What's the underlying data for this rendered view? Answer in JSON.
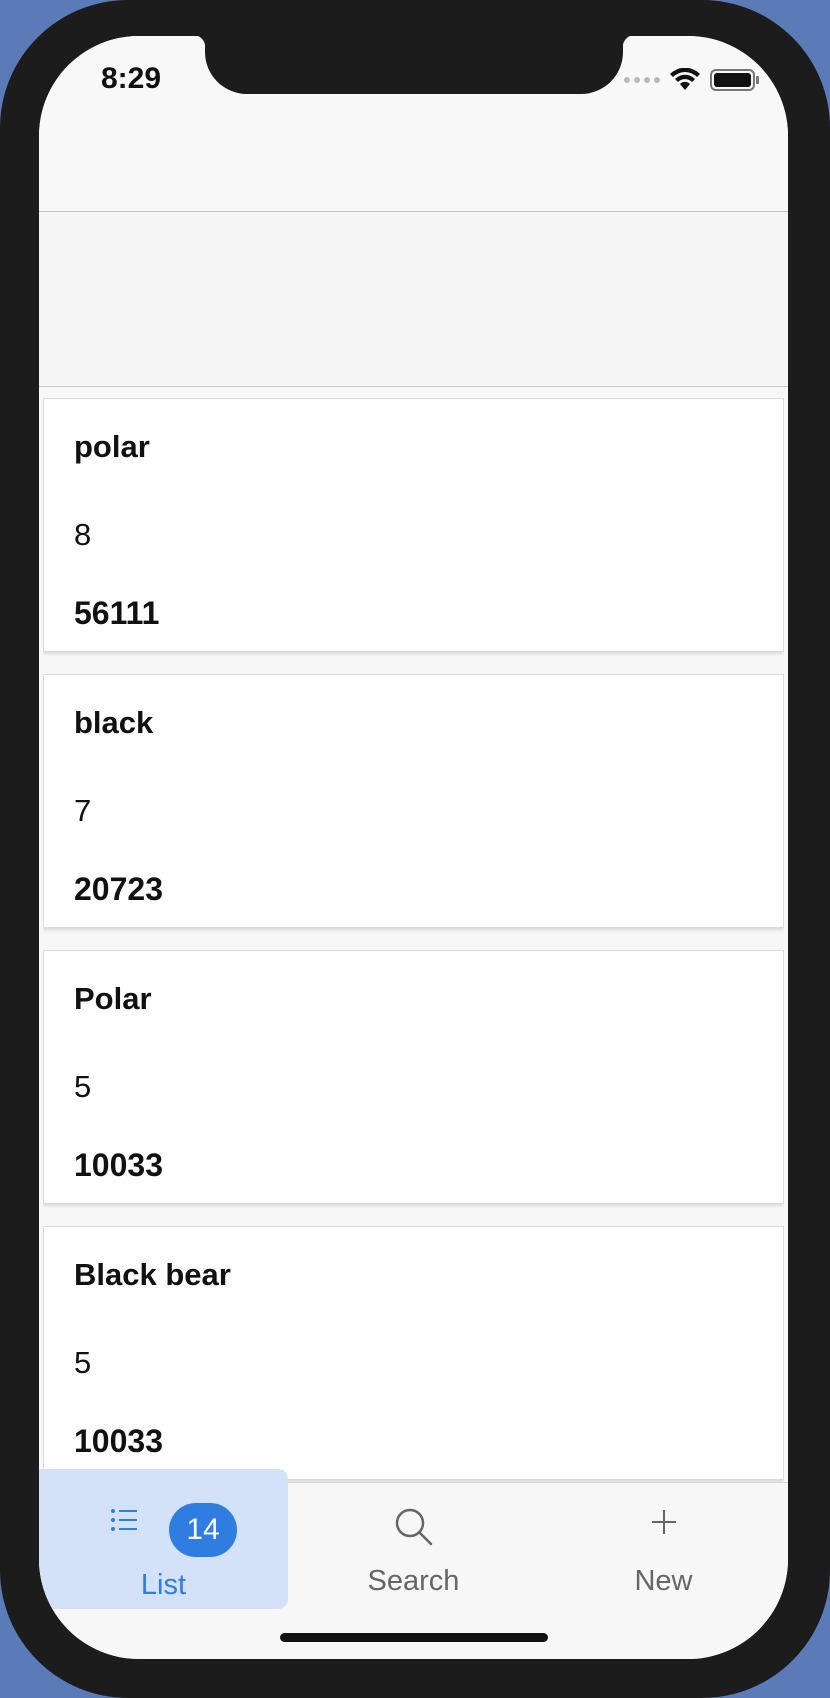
{
  "status_bar": {
    "time": "8:29"
  },
  "list": {
    "items": [
      {
        "name": "polar",
        "count": "8",
        "total": "56111"
      },
      {
        "name": "black",
        "count": "7",
        "total": "20723"
      },
      {
        "name": "Polar",
        "count": "5",
        "total": "10033"
      },
      {
        "name": "Black bear",
        "count": "5",
        "total": "10033"
      }
    ]
  },
  "tab_bar": {
    "tabs": [
      {
        "label": "List",
        "icon": "list-icon",
        "badge": "14",
        "active": true
      },
      {
        "label": "Search",
        "icon": "search-icon",
        "active": false
      },
      {
        "label": "New",
        "icon": "plus-icon",
        "active": false
      }
    ]
  },
  "colors": {
    "accent": "#2f7de1",
    "active_tab_bg": "#d3e2f8"
  }
}
